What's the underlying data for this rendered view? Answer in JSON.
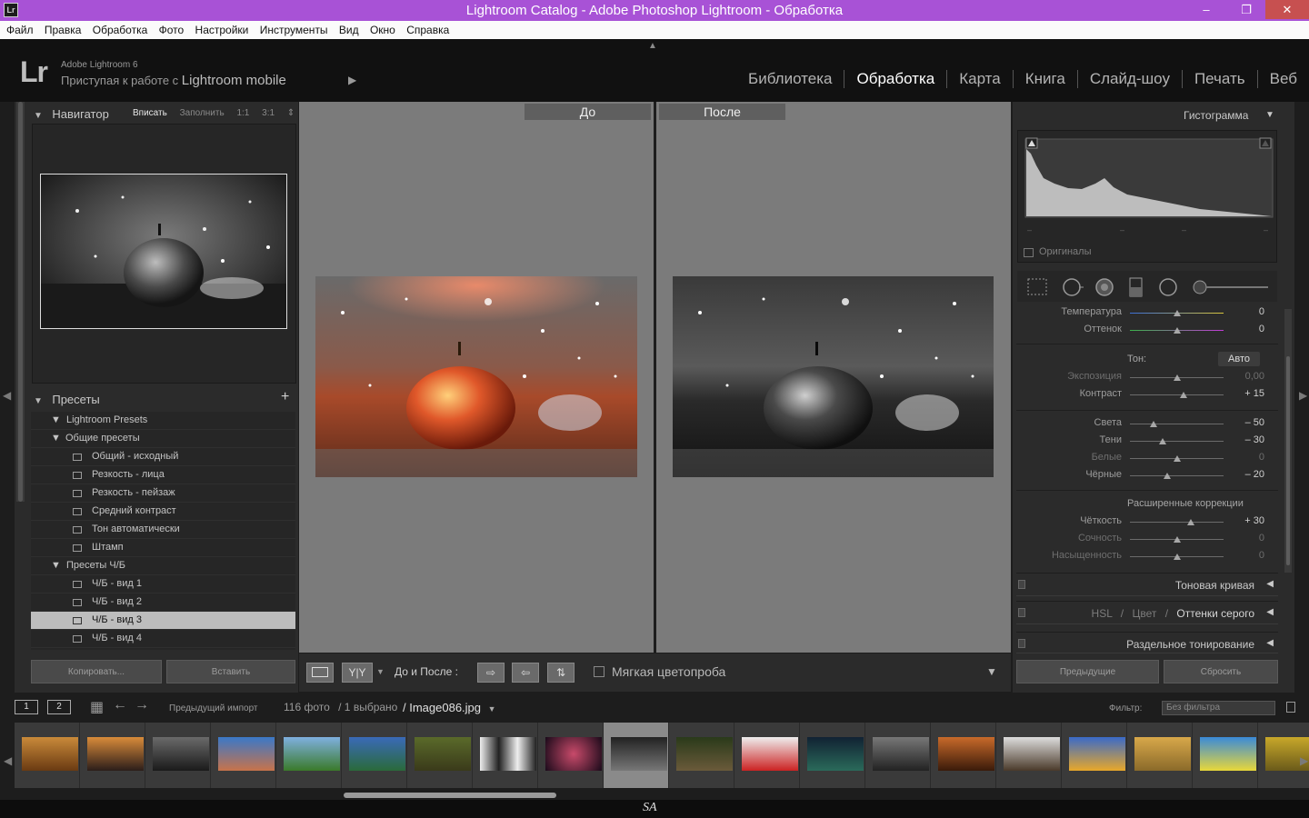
{
  "window": {
    "title": "Lightroom Catalog - Adobe Photoshop Lightroom - Обработка",
    "app_icon": "Lr",
    "min_glyph": "‒",
    "max_glyph": "❐",
    "close_glyph": "✕"
  },
  "menu": [
    "Файл",
    "Правка",
    "Обработка",
    "Фото",
    "Настройки",
    "Инструменты",
    "Вид",
    "Окно",
    "Справка"
  ],
  "identity": {
    "logo": "Lr",
    "line1": "Adobe Lightroom 6",
    "line2_prefix": "Приступая к работе с",
    "line2_emph": "Lightroom mobile",
    "arrow": "▶",
    "modules": [
      "Библиотека",
      "Обработка",
      "Карта",
      "Книга",
      "Слайд-шоу",
      "Печать",
      "Веб"
    ],
    "active_module": "Обработка"
  },
  "navigator": {
    "title": "Навигатор",
    "options": [
      "Вписать",
      "Заполнить",
      "1:1",
      "3:1"
    ],
    "active_option": "Вписать"
  },
  "presets": {
    "title": "Пресеты",
    "add": "+",
    "items": [
      {
        "label": "Lightroom Presets",
        "type": "folder"
      },
      {
        "label": "Общие пресеты",
        "type": "folder"
      },
      {
        "label": "Общий - исходный",
        "type": "preset"
      },
      {
        "label": "Резкость - лица",
        "type": "preset"
      },
      {
        "label": "Резкость - пейзаж",
        "type": "preset"
      },
      {
        "label": "Средний контраст",
        "type": "preset"
      },
      {
        "label": "Тон автоматически",
        "type": "preset"
      },
      {
        "label": "Штамп",
        "type": "preset"
      },
      {
        "label": "Пресеты Ч/Б",
        "type": "folder"
      },
      {
        "label": "Ч/Б - вид 1",
        "type": "preset"
      },
      {
        "label": "Ч/Б - вид 2",
        "type": "preset"
      },
      {
        "label": "Ч/Б - вид 3",
        "type": "preset",
        "selected": true
      },
      {
        "label": "Ч/Б - вид 4",
        "type": "preset"
      }
    ]
  },
  "left_buttons": {
    "copy": "Копировать...",
    "paste": "Вставить"
  },
  "compare": {
    "before": "До",
    "after": "После"
  },
  "toolbar": {
    "yy": "Y|Y",
    "label": "До и После :",
    "soft_proof": "Мягкая цветопроба"
  },
  "histogram": {
    "title": "Гистограмма",
    "originals": "Оригиналы"
  },
  "sliders_top": [
    {
      "label": "Температура",
      "value": "0",
      "pos": 0.5,
      "grad": "linear-gradient(90deg,#3b6fd8,#d8c43b)"
    },
    {
      "label": "Оттенок",
      "value": "0",
      "pos": 0.5,
      "grad": "linear-gradient(90deg,#3bb24a,#c23bd8)"
    }
  ],
  "tone": {
    "label": "Тон:",
    "auto": "Авто",
    "sliders": [
      {
        "label": "Экспозиция",
        "value": "0,00",
        "pos": 0.5,
        "dim": true
      },
      {
        "label": "Контраст",
        "value": "+ 15",
        "pos": 0.575
      }
    ],
    "sliders2": [
      {
        "label": "Света",
        "value": "– 50",
        "pos": 0.25
      },
      {
        "label": "Тени",
        "value": "– 30",
        "pos": 0.35
      },
      {
        "label": "Белые",
        "value": "0",
        "pos": 0.5,
        "dim": true
      },
      {
        "label": "Чёрные",
        "value": "– 20",
        "pos": 0.4
      }
    ]
  },
  "advanced": {
    "label": "Расширенные коррекции",
    "sliders": [
      {
        "label": "Чёткость",
        "value": "+ 30",
        "pos": 0.65
      },
      {
        "label": "Сочность",
        "value": "0",
        "pos": 0.5,
        "dim": true
      },
      {
        "label": "Насыщенность",
        "value": "0",
        "pos": 0.5,
        "dim": true
      }
    ]
  },
  "panels": {
    "tone_curve": "Тоновая кривая",
    "hsl": "HSL",
    "sep1": "/",
    "color": "Цвет",
    "sep2": "/",
    "grayscale": "Оттенки серого",
    "split": "Раздельное тонирование"
  },
  "right_buttons": {
    "previous": "Предыдущие",
    "reset": "Сбросить"
  },
  "filmstrip": {
    "screen1": "1",
    "screen2": "2",
    "source": "Предыдущий импорт",
    "count": "116 фото",
    "selected": "/ 1 выбрано",
    "file": "/ Image086.jpg",
    "filter_label": "Фильтр:",
    "filter_value": "Без фильтра",
    "thumbs": [
      "linear-gradient(180deg,#c98a3a,#6a3a12)",
      "linear-gradient(180deg,#d98b3a,#2b1d1a)",
      "linear-gradient(180deg,#6a6a6a,#1a1a1a)",
      "linear-gradient(180deg,#3a78c8,#c8734a)",
      "linear-gradient(180deg,#7fb0e0,#3a7a2a)",
      "linear-gradient(180deg,#3a6ab8,#2a6a3a)",
      "linear-gradient(180deg,#5a6a2a,#3a3a1a)",
      "linear-gradient(90deg,#eee,#222,#eee,#222)",
      "radial-gradient(circle,#c84a6a,#1a0a1a)",
      "linear-gradient(180deg,#222,#777)",
      "linear-gradient(180deg,#2a3a1a,#6a5a3a)",
      "linear-gradient(180deg,#eee,#c22)",
      "linear-gradient(180deg,#123,#2a6a5a)",
      "linear-gradient(180deg,#777,#222)",
      "linear-gradient(180deg,#c86a2a,#3a1a0a)",
      "linear-gradient(180deg,#ddd,#4a3a2a)",
      "linear-gradient(180deg,#3a6ac8,#e8a82a)",
      "linear-gradient(180deg,#d8a84a,#8a6a2a)",
      "linear-gradient(180deg,#3a8ad8,#e8d83a)",
      "linear-gradient(180deg,#c8a82a,#6a5a1a)"
    ],
    "selected_index": 9
  },
  "watermark": "SA"
}
